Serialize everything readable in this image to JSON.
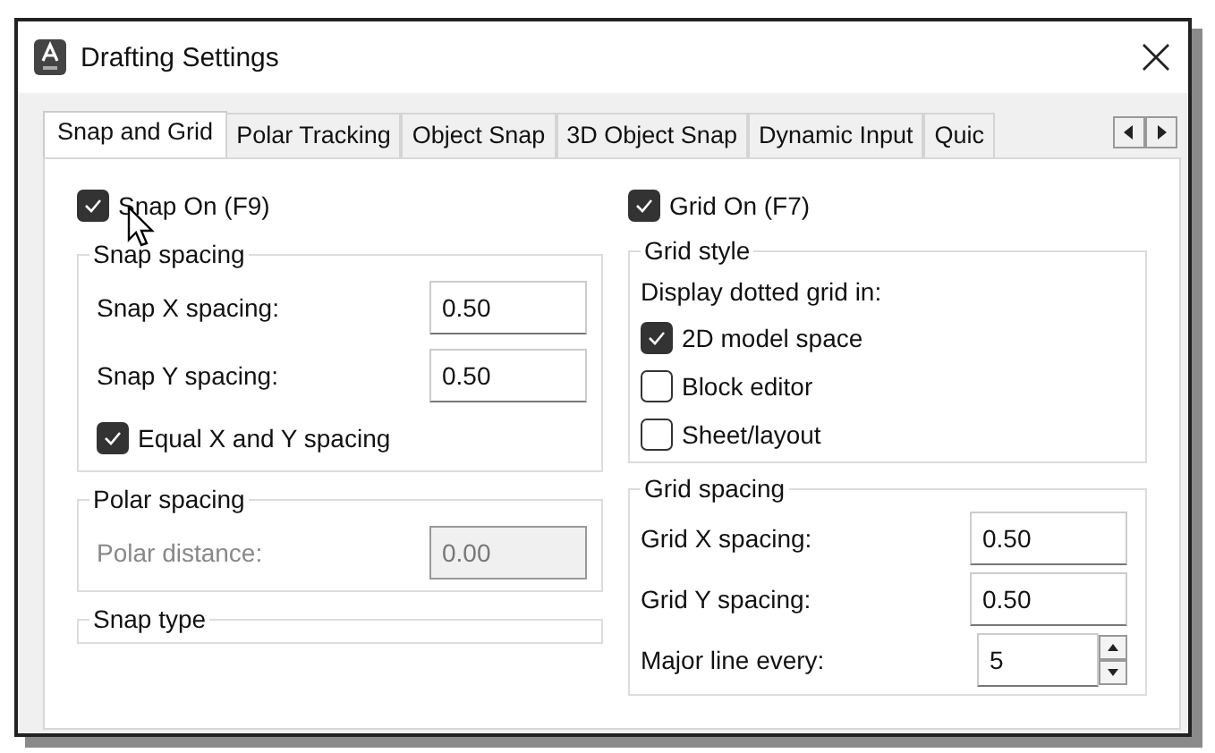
{
  "window": {
    "title": "Drafting Settings"
  },
  "tabs": [
    {
      "label": "Snap and Grid",
      "selected": true
    },
    {
      "label": "Polar Tracking",
      "selected": false
    },
    {
      "label": "Object Snap",
      "selected": false
    },
    {
      "label": "3D Object Snap",
      "selected": false
    },
    {
      "label": "Dynamic Input",
      "selected": false
    },
    {
      "label": "Quic",
      "selected": false
    }
  ],
  "left": [
    {
      "kind": "check",
      "label": "Snap On (F9)",
      "checked": true
    },
    {
      "kind": "group",
      "title": "Snap spacing",
      "items": [
        {
          "kind": "field",
          "label": "Snap X spacing:",
          "value": "0.50",
          "disabled": false
        },
        {
          "kind": "field",
          "label": "Snap Y spacing:",
          "value": "0.50",
          "disabled": false
        },
        {
          "kind": "check",
          "label": "Equal X and Y spacing",
          "checked": true
        }
      ]
    },
    {
      "kind": "group",
      "title": "Polar spacing",
      "items": [
        {
          "kind": "field",
          "label": "Polar distance:",
          "value": "0.00",
          "disabled": true
        }
      ]
    },
    {
      "kind": "group",
      "title": "Snap type"
    }
  ],
  "right": [
    {
      "kind": "check",
      "label": "Grid On (F7)",
      "checked": true
    },
    {
      "kind": "group",
      "title": "Grid style",
      "items": [
        {
          "kind": "caption",
          "label": "Display dotted grid in:"
        },
        {
          "kind": "check",
          "label": "2D model space",
          "checked": true
        },
        {
          "kind": "check",
          "label": "Block editor",
          "checked": false
        },
        {
          "kind": "check",
          "label": "Sheet/layout",
          "checked": false
        }
      ]
    },
    {
      "kind": "group",
      "title": "Grid spacing",
      "items": [
        {
          "kind": "field",
          "label": "Grid X spacing:",
          "value": "0.50",
          "disabled": false
        },
        {
          "kind": "field",
          "label": "Grid Y spacing:",
          "value": "0.50",
          "disabled": false
        },
        {
          "kind": "spinner",
          "label": "Major line every:",
          "value": "5",
          "disabled": false
        }
      ]
    }
  ]
}
